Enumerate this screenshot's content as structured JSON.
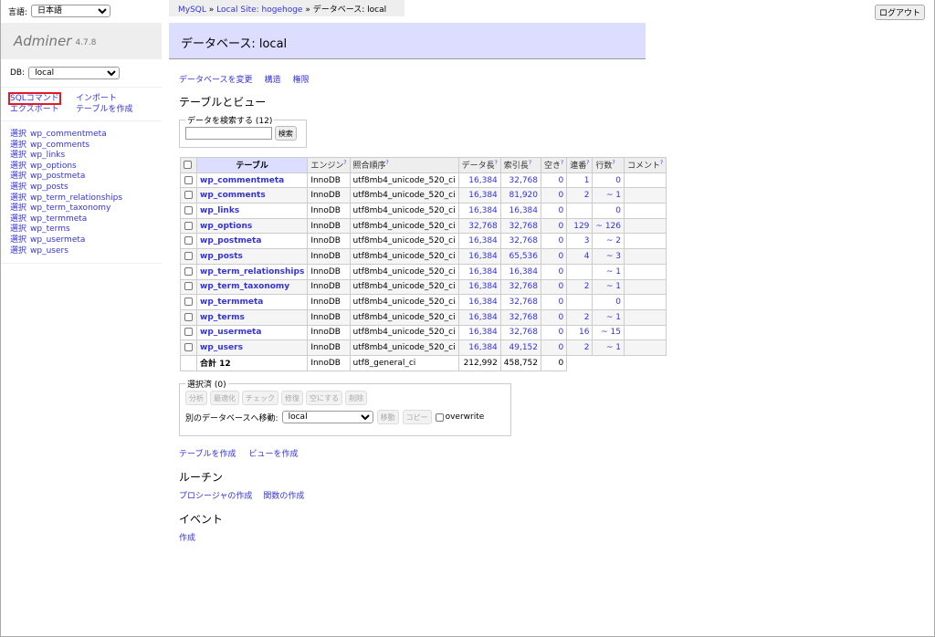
{
  "lang": {
    "label": "言語:",
    "selected": "日本語"
  },
  "app": {
    "name": "Adminer",
    "version": "4.7.8"
  },
  "db_select": {
    "label": "DB:",
    "selected": "local"
  },
  "sidebar": {
    "links": [
      {
        "label": "SQLコマンド",
        "highlighted": true
      },
      {
        "label": "インポート"
      },
      {
        "label": "エクスポート"
      },
      {
        "label": "テーブルを作成"
      }
    ],
    "select_label": "選択",
    "tables": [
      "wp_commentmeta",
      "wp_comments",
      "wp_links",
      "wp_options",
      "wp_postmeta",
      "wp_posts",
      "wp_term_relationships",
      "wp_term_taxonomy",
      "wp_termmeta",
      "wp_terms",
      "wp_usermeta",
      "wp_users"
    ]
  },
  "breadcrumb": {
    "items": [
      "MySQL",
      "Local Site: hogehoge"
    ],
    "separator": "»",
    "current": "データベース: local"
  },
  "header": {
    "title": "データベース: local"
  },
  "logout_label": "ログアウト",
  "db_links": [
    "データベースを変更",
    "構造",
    "権限"
  ],
  "tables_heading": "テーブルとビュー",
  "search": {
    "legend": "データを検索する (12)",
    "value": "",
    "button": "検索"
  },
  "table": {
    "headers": {
      "table": "テーブル",
      "engine": "エンジン",
      "collation": "照合順序",
      "data_length": "データ長",
      "index_length": "索引長",
      "free": "空き",
      "auto_increment": "連番",
      "rows": "行数",
      "comment": "コメント"
    },
    "help_mark": "?",
    "rows": [
      {
        "name": "wp_commentmeta",
        "engine": "InnoDB",
        "collation": "utf8mb4_unicode_520_ci",
        "data": "16,384",
        "index": "32,768",
        "free": "0",
        "ai": "1",
        "rows": "0",
        "comment": ""
      },
      {
        "name": "wp_comments",
        "engine": "InnoDB",
        "collation": "utf8mb4_unicode_520_ci",
        "data": "16,384",
        "index": "81,920",
        "free": "0",
        "ai": "2",
        "rows": "~ 1",
        "comment": ""
      },
      {
        "name": "wp_links",
        "engine": "InnoDB",
        "collation": "utf8mb4_unicode_520_ci",
        "data": "16,384",
        "index": "16,384",
        "free": "0",
        "ai": "",
        "rows": "0",
        "comment": ""
      },
      {
        "name": "wp_options",
        "engine": "InnoDB",
        "collation": "utf8mb4_unicode_520_ci",
        "data": "32,768",
        "index": "32,768",
        "free": "0",
        "ai": "129",
        "rows": "~ 126",
        "comment": ""
      },
      {
        "name": "wp_postmeta",
        "engine": "InnoDB",
        "collation": "utf8mb4_unicode_520_ci",
        "data": "16,384",
        "index": "32,768",
        "free": "0",
        "ai": "3",
        "rows": "~ 2",
        "comment": ""
      },
      {
        "name": "wp_posts",
        "engine": "InnoDB",
        "collation": "utf8mb4_unicode_520_ci",
        "data": "16,384",
        "index": "65,536",
        "free": "0",
        "ai": "4",
        "rows": "~ 3",
        "comment": ""
      },
      {
        "name": "wp_term_relationships",
        "engine": "InnoDB",
        "collation": "utf8mb4_unicode_520_ci",
        "data": "16,384",
        "index": "16,384",
        "free": "0",
        "ai": "",
        "rows": "~ 1",
        "comment": ""
      },
      {
        "name": "wp_term_taxonomy",
        "engine": "InnoDB",
        "collation": "utf8mb4_unicode_520_ci",
        "data": "16,384",
        "index": "32,768",
        "free": "0",
        "ai": "2",
        "rows": "~ 1",
        "comment": ""
      },
      {
        "name": "wp_termmeta",
        "engine": "InnoDB",
        "collation": "utf8mb4_unicode_520_ci",
        "data": "16,384",
        "index": "32,768",
        "free": "0",
        "ai": "",
        "rows": "0",
        "comment": ""
      },
      {
        "name": "wp_terms",
        "engine": "InnoDB",
        "collation": "utf8mb4_unicode_520_ci",
        "data": "16,384",
        "index": "32,768",
        "free": "0",
        "ai": "2",
        "rows": "~ 1",
        "comment": ""
      },
      {
        "name": "wp_usermeta",
        "engine": "InnoDB",
        "collation": "utf8mb4_unicode_520_ci",
        "data": "16,384",
        "index": "32,768",
        "free": "0",
        "ai": "16",
        "rows": "~ 15",
        "comment": ""
      },
      {
        "name": "wp_users",
        "engine": "InnoDB",
        "collation": "utf8mb4_unicode_520_ci",
        "data": "16,384",
        "index": "49,152",
        "free": "0",
        "ai": "2",
        "rows": "~ 1",
        "comment": ""
      }
    ],
    "footer": {
      "label": "合計 12",
      "engine": "InnoDB",
      "collation": "utf8_general_ci",
      "data": "212,992",
      "index": "458,752",
      "free": "0"
    }
  },
  "selected": {
    "legend": "選択済 (0)",
    "buttons": [
      "分析",
      "最適化",
      "チェック",
      "修復",
      "空にする",
      "削除"
    ],
    "move_label": "別のデータベースへ移動:",
    "move_target": "local",
    "move_button": "移動",
    "copy_button": "コピー",
    "overwrite_label": "overwrite"
  },
  "create_links": [
    "テーブルを作成",
    "ビューを作成"
  ],
  "routines": {
    "heading": "ルーチン",
    "links": [
      "プロシージャの作成",
      "関数の作成"
    ]
  },
  "events": {
    "heading": "イベント",
    "links": [
      "作成"
    ]
  }
}
